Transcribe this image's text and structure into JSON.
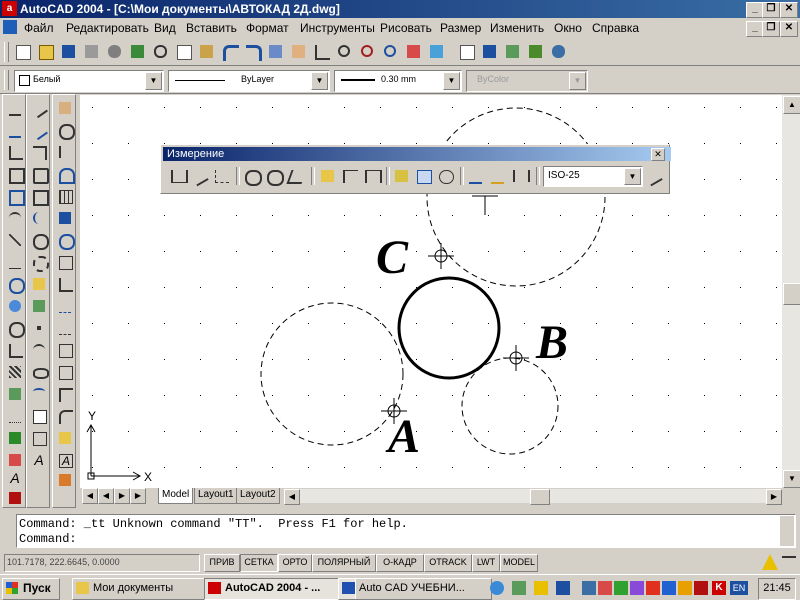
{
  "window": {
    "title": "AutoCAD 2004 - [C:\\Мои документы\\АВТОКАД 2Д.dwg]",
    "controls": [
      "_",
      "❐",
      "✕"
    ]
  },
  "menu": {
    "items": [
      "Файл",
      "Редактировать",
      "Вид",
      "Вставить",
      "Формат",
      "Инструменты",
      "Рисовать",
      "Размер",
      "Изменить",
      "Окно",
      "Справка"
    ],
    "doc_controls": [
      "_",
      "❐",
      "✕"
    ]
  },
  "properties": {
    "color": "Белый",
    "linetype": "ByLayer",
    "lineweight": "0.30 mm",
    "plotstyle": "ByColor"
  },
  "dimension_toolbar": {
    "title": "Измерение",
    "close": "✕",
    "style": "ISO-25"
  },
  "drawing": {
    "labels": [
      "C",
      "B",
      "A"
    ],
    "axis_x": "X",
    "axis_y": "Y"
  },
  "layout_tabs": [
    "Model",
    "Layout1",
    "Layout2"
  ],
  "command": {
    "history": "Command: _tt Unknown command \"TT\".  Press F1 for help.",
    "prompt": "Command:"
  },
  "status": {
    "coords": "101.7178, 222.6645, 0.0000",
    "toggles": [
      "ПРИВ",
      "СЕТКА",
      "ОРТО",
      "ПОЛЯРНЫЙ",
      "О-КАДР",
      "OTRACK",
      "LWT",
      "MODEL"
    ]
  },
  "taskbar": {
    "start": "Пуск",
    "tasks": [
      "Мои документы",
      "AutoCAD 2004 - ...",
      "Auto CAD УЧЕБНИ..."
    ],
    "lang": "EN",
    "clock": "21:45"
  },
  "colors": {
    "title_start": "#0a246a",
    "title_end": "#3a6ea5",
    "chrome": "#d4d0c8",
    "canvas": "#ffffff"
  }
}
